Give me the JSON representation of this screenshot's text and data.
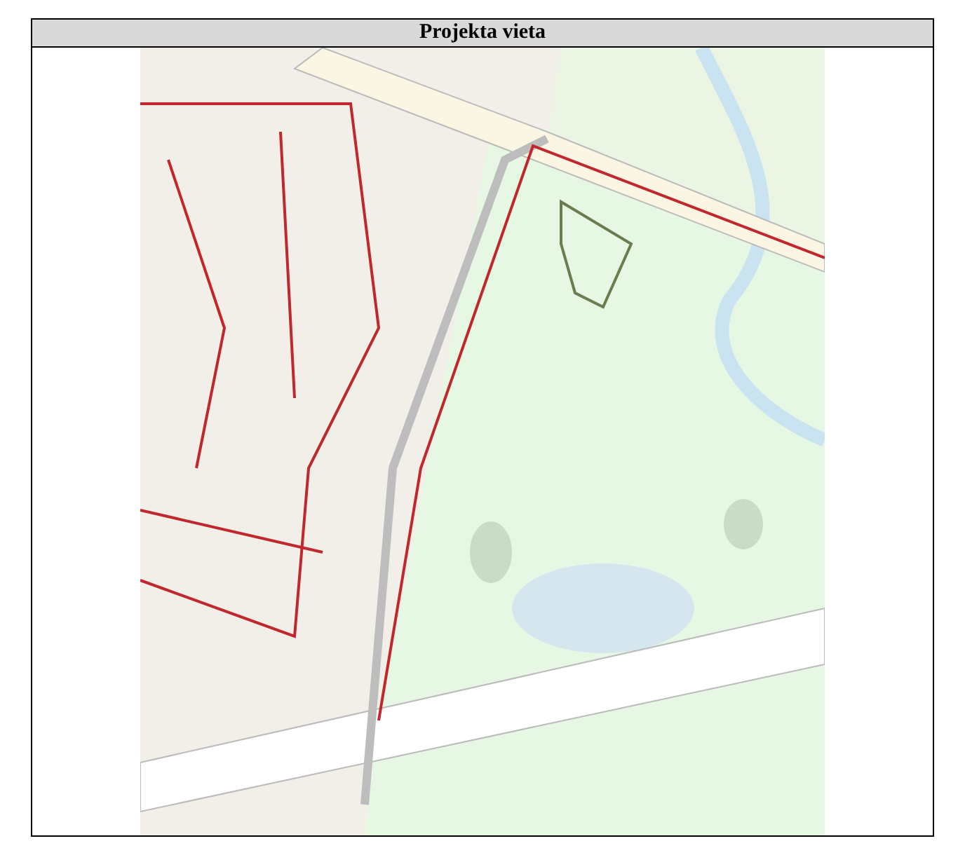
{
  "table": {
    "header": "Projekta vieta"
  }
}
